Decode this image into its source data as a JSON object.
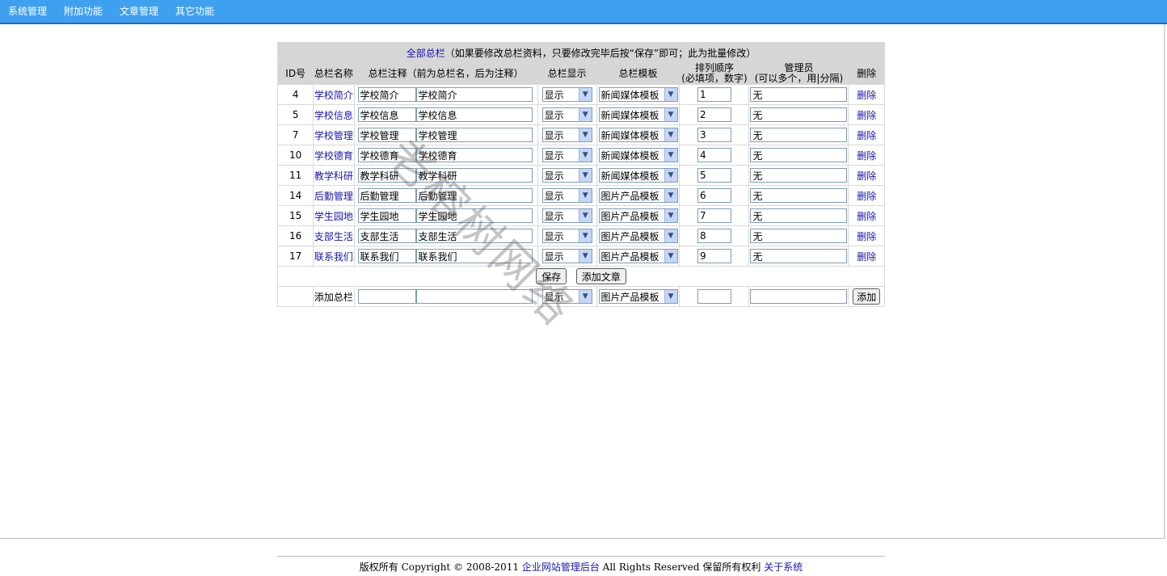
{
  "nav": {
    "items": [
      "系统管理",
      "附加功能",
      "文章管理",
      "其它功能"
    ]
  },
  "table": {
    "title_link": "全部总栏",
    "title_note": "（如果要修改总栏资料，只要修改完毕后按“保存”即可；此为批量修改）",
    "columns": [
      "ID号",
      "总栏名称",
      "总栏注释（前为总栏名，后为注释）",
      "总栏显示",
      "总栏模板",
      "排列顺序",
      "(必填项，数字)",
      "管理员",
      "(可以多个，用|分隔)",
      "删除"
    ],
    "rows": [
      {
        "id": "4",
        "name": "学校简介",
        "alias": "学校简介",
        "note": "学校简介",
        "show": "显示",
        "template": "新闻媒体模板",
        "order": "1",
        "admin": "无",
        "del": "删除"
      },
      {
        "id": "5",
        "name": "学校信息",
        "alias": "学校信息",
        "note": "学校信息",
        "show": "显示",
        "template": "新闻媒体模板",
        "order": "2",
        "admin": "无",
        "del": "删除"
      },
      {
        "id": "7",
        "name": "学校管理",
        "alias": "学校管理",
        "note": "学校管理",
        "show": "显示",
        "template": "新闻媒体模板",
        "order": "3",
        "admin": "无",
        "del": "删除"
      },
      {
        "id": "10",
        "name": "学校德育",
        "alias": "学校德育",
        "note": "学校德育",
        "show": "显示",
        "template": "新闻媒体模板",
        "order": "4",
        "admin": "无",
        "del": "删除"
      },
      {
        "id": "11",
        "name": "教学科研",
        "alias": "教学科研",
        "note": "教学科研",
        "show": "显示",
        "template": "新闻媒体模板",
        "order": "5",
        "admin": "无",
        "del": "删除"
      },
      {
        "id": "14",
        "name": "后勤管理",
        "alias": "后勤管理",
        "note": "后勤管理",
        "show": "显示",
        "template": "图片产品模板",
        "order": "6",
        "admin": "无",
        "del": "删除"
      },
      {
        "id": "15",
        "name": "学生园地",
        "alias": "学生园地",
        "note": "学生园地",
        "show": "显示",
        "template": "图片产品模板",
        "order": "7",
        "admin": "无",
        "del": "删除"
      },
      {
        "id": "16",
        "name": "支部生活",
        "alias": "支部生活",
        "note": "支部生活",
        "show": "显示",
        "template": "图片产品模板",
        "order": "8",
        "admin": "无",
        "del": "删除"
      },
      {
        "id": "17",
        "name": "联系我们",
        "alias": "联系我们",
        "note": "联系我们",
        "show": "显示",
        "template": "图片产品模板",
        "order": "9",
        "admin": "无",
        "del": "删除"
      }
    ],
    "save_label": "保存",
    "add_article_label": "添加文章",
    "add_row": {
      "label": "添加总栏",
      "show": "显示",
      "template": "图片产品模板",
      "button": "添加"
    }
  },
  "footer": {
    "prefix": "版权所有 Copyright © 2008-2011 ",
    "link1": "企业网站管理后台",
    "middle": " All Rights Reserved 保留所有权利 ",
    "link2": "关于系统"
  },
  "watermark": "老榕树网络",
  "colors": {
    "topbar": "#3fa0ef",
    "header_bg": "#d6d6d6",
    "link": "#1515b5"
  }
}
